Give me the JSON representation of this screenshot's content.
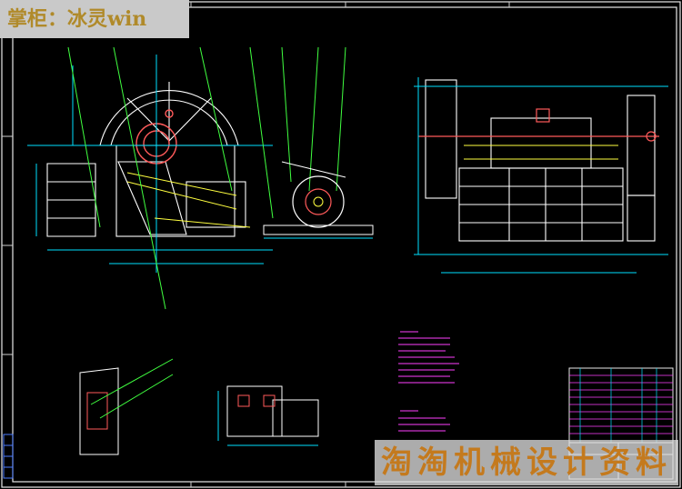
{
  "watermark_top": {
    "text": "掌柜：冰灵win"
  },
  "watermark_bottom": {
    "text": "淘淘机械设计资料"
  }
}
